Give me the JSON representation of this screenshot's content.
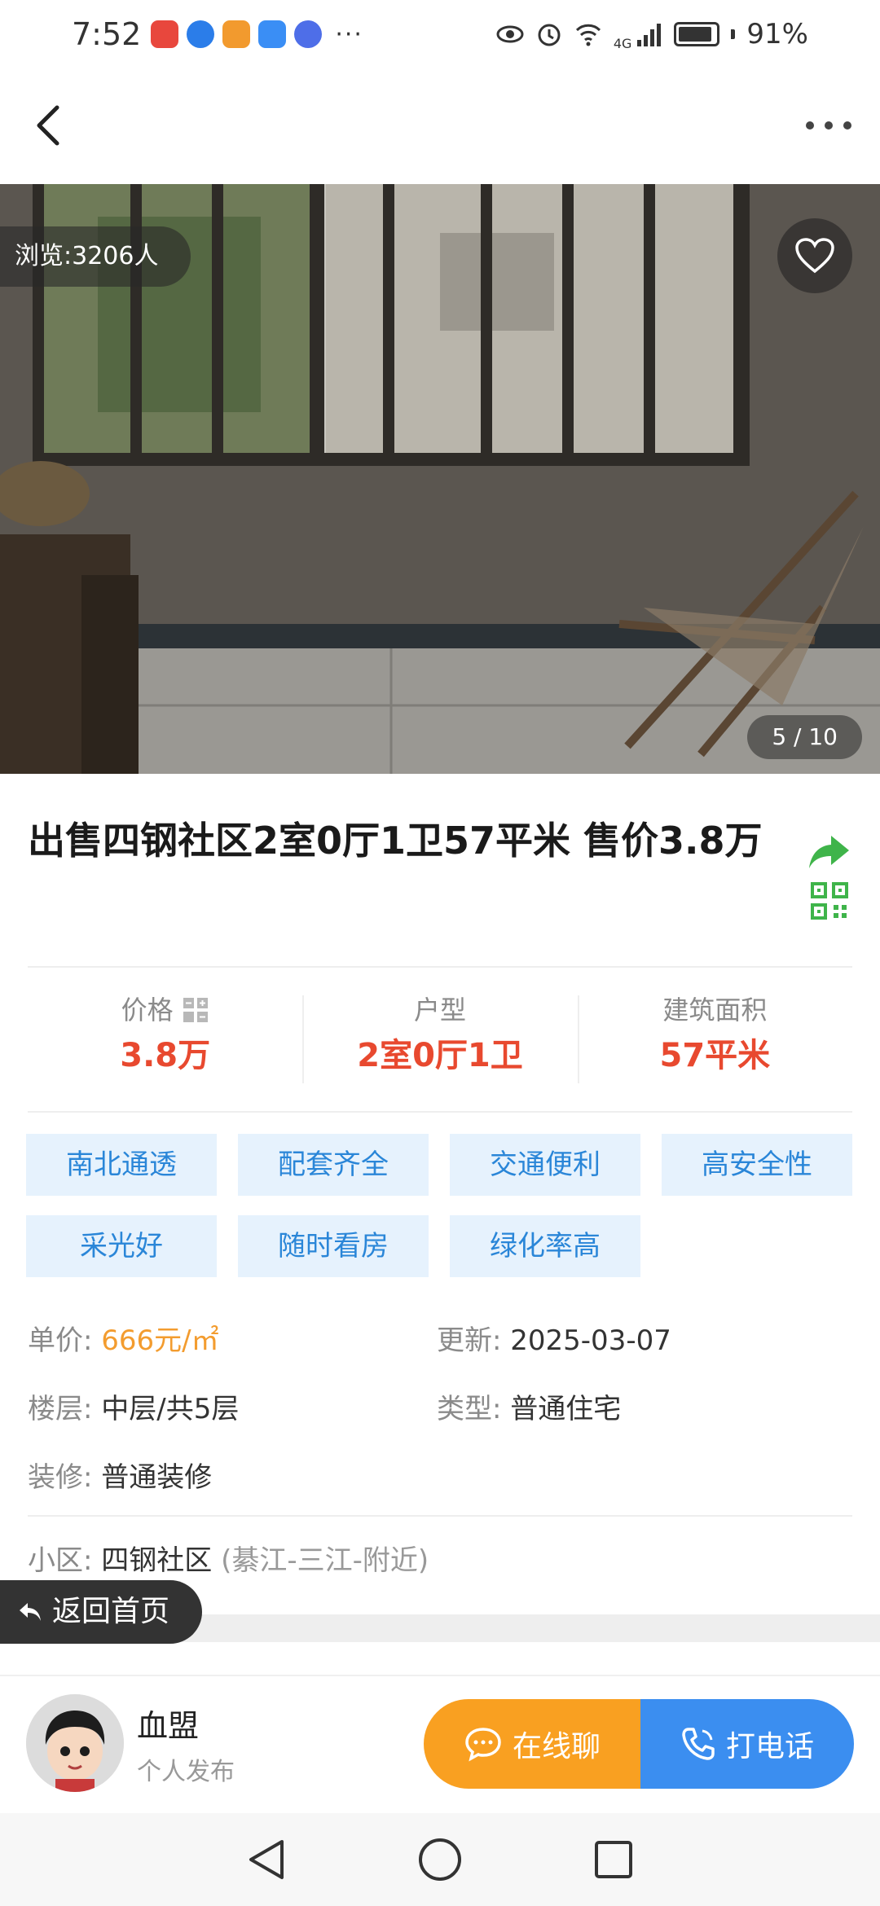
{
  "status_bar": {
    "time": "7:52",
    "battery": "91%",
    "network": "4G",
    "app_icons": [
      {
        "name": "huawei-app-icon",
        "color": "#e8473d"
      },
      {
        "name": "browser-app-icon",
        "color": "#2b7de9"
      },
      {
        "name": "video-app-icon",
        "color": "#f29a2e"
      },
      {
        "name": "cloud-app-icon",
        "color": "#3a8ef5"
      },
      {
        "name": "music-app-icon",
        "color": "#4e6ee8"
      }
    ],
    "more": "···"
  },
  "hero": {
    "views": "浏览:3206人",
    "counter": "5 / 10"
  },
  "listing": {
    "title": "出售四钢社区2室0厅1卫57平米 售价3.8万"
  },
  "stats": [
    {
      "label": "价格",
      "value": "3.8万"
    },
    {
      "label": "户型",
      "value": "2室0厅1卫"
    },
    {
      "label": "建筑面积",
      "value": "57平米"
    }
  ],
  "tags": [
    "南北通透",
    "配套齐全",
    "交通便利",
    "高安全性",
    "采光好",
    "随时看房",
    "绿化率高"
  ],
  "details": {
    "unit_price_label": "单价: ",
    "unit_price": "666元/㎡",
    "updated_label": "更新: ",
    "updated": "2025-03-07",
    "floor_label": "楼层: ",
    "floor": "中层/共5层",
    "type_label": "类型: ",
    "type": "普通住宅",
    "decor_label": "装修: ",
    "decor": "普通装修",
    "community_label": "小区: ",
    "community": "四钢社区",
    "community_area": "(綦江-三江-附近)"
  },
  "home_button": "返回首页",
  "seller": {
    "name": "血盟",
    "sub": "个人发布"
  },
  "actions": {
    "chat": "在线聊",
    "call": "打电话"
  },
  "colors": {
    "accent_red": "#e8492f",
    "tag_bg": "#e6f2fd",
    "tag_text": "#2a86d8",
    "chat_orange": "#f9a021",
    "call_blue": "#3b8ef0",
    "share_green": "#3fb44a"
  }
}
